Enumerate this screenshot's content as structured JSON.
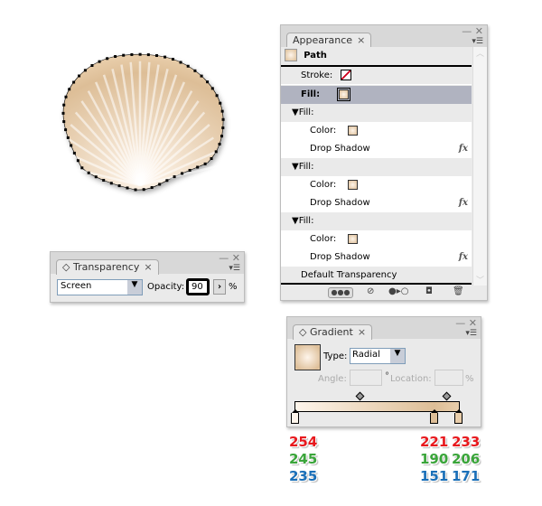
{
  "appearance": {
    "tab": "Appearance",
    "close": "×",
    "object": "Path",
    "stroke_label": "Stroke:",
    "fill_label": "Fill:",
    "fill_groups": [
      {
        "header": "Fill:",
        "color_label": "Color:",
        "effect": "Drop Shadow",
        "fx": "fx"
      },
      {
        "header": "Fill:",
        "color_label": "Color:",
        "effect": "Drop Shadow",
        "fx": "fx"
      },
      {
        "header": "Fill:",
        "color_label": "Color:",
        "effect": "Drop Shadow",
        "fx": "fx"
      }
    ],
    "default_transparency": "Default Transparency"
  },
  "transparency": {
    "tab": "Transparency",
    "close": "×",
    "blend_mode": "Screen",
    "opacity_label": "Opacity:",
    "opacity": "90",
    "percent": "%"
  },
  "gradient": {
    "tab": "Gradient",
    "close": "×",
    "type_label": "Type:",
    "type": "Radial",
    "angle_label": "Angle:",
    "degree": "°",
    "location_label": "Location:",
    "percent": "%",
    "stops": [
      {
        "position": 0,
        "r": "254",
        "g": "245",
        "b": "235"
      },
      {
        "position": 85,
        "r": "221",
        "g": "190",
        "b": "151"
      },
      {
        "position": 100,
        "r": "233",
        "g": "206",
        "b": "171"
      }
    ],
    "midpoints": [
      40,
      93
    ]
  },
  "colors": {
    "selected_row": "#b0b3c0",
    "stop1": "#fef5eb",
    "stop2": "#ddbe97",
    "stop3": "#e9ceab"
  }
}
